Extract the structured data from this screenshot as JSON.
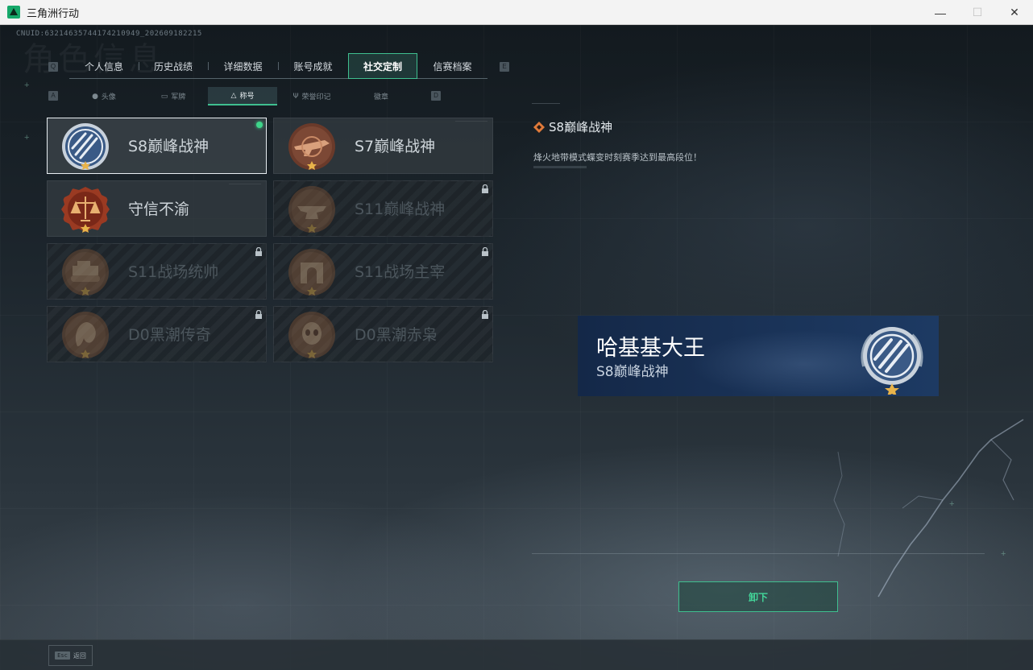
{
  "window": {
    "title": "三角洲行动",
    "minimize": "—",
    "maximize": "☐",
    "close": "✕"
  },
  "uid": "CNUID:632146357441742109­49_202609182215",
  "bg_title": "角色信息",
  "key_hints": {
    "prev_tab": "Q",
    "next_tab": "E",
    "prev_sub": "A",
    "next_sub": "D"
  },
  "tabs": [
    {
      "label": "个人信息"
    },
    {
      "label": "历史战绩"
    },
    {
      "label": "详细数据"
    },
    {
      "label": "账号成就"
    },
    {
      "label": "社交定制",
      "active": true
    },
    {
      "label": "信赛档案"
    }
  ],
  "subtabs": [
    {
      "label": "头像",
      "icon": "person-icon"
    },
    {
      "label": "军牌",
      "icon": "dogtag-icon"
    },
    {
      "label": "称号",
      "icon": "title-icon",
      "active": true
    },
    {
      "label": "荣誉印记",
      "icon": "honor-icon"
    },
    {
      "label": "徽章",
      "icon": ""
    }
  ],
  "cards": [
    {
      "name": "S8巅峰战神",
      "badge": "blue-emblem",
      "selected": true,
      "equipped": true,
      "locked": false
    },
    {
      "name": "S7巅峰战神",
      "badge": "bronze-rifle",
      "selected": false,
      "locked": false
    },
    {
      "name": "守信不渝",
      "badge": "red-scales",
      "selected": false,
      "locked": false
    },
    {
      "name": "S11巅峰战神",
      "badge": "bronze-anvil",
      "locked": true
    },
    {
      "name": "S11战场统帅",
      "badge": "bronze-tank",
      "locked": true
    },
    {
      "name": "S11战场主宰",
      "badge": "bronze-arch",
      "locked": true
    },
    {
      "name": "D0黑潮传奇",
      "badge": "bronze-creature",
      "locked": true
    },
    {
      "name": "D0黑潮赤枭",
      "badge": "bronze-skull",
      "locked": true
    }
  ],
  "detail": {
    "title": "S8巅峰战神",
    "description": "烽火地带模式蝶变时刻赛季达到最高段位！"
  },
  "preview": {
    "player_name": "哈基基大王",
    "title": "S8巅峰战神"
  },
  "unequip_label": "卸下",
  "bottom": {
    "esc_key": "Esc",
    "back_label": "返回"
  },
  "colors": {
    "accent": "#3fbf8f",
    "equipped": "#3ed58a",
    "banner": "#1a3358"
  }
}
